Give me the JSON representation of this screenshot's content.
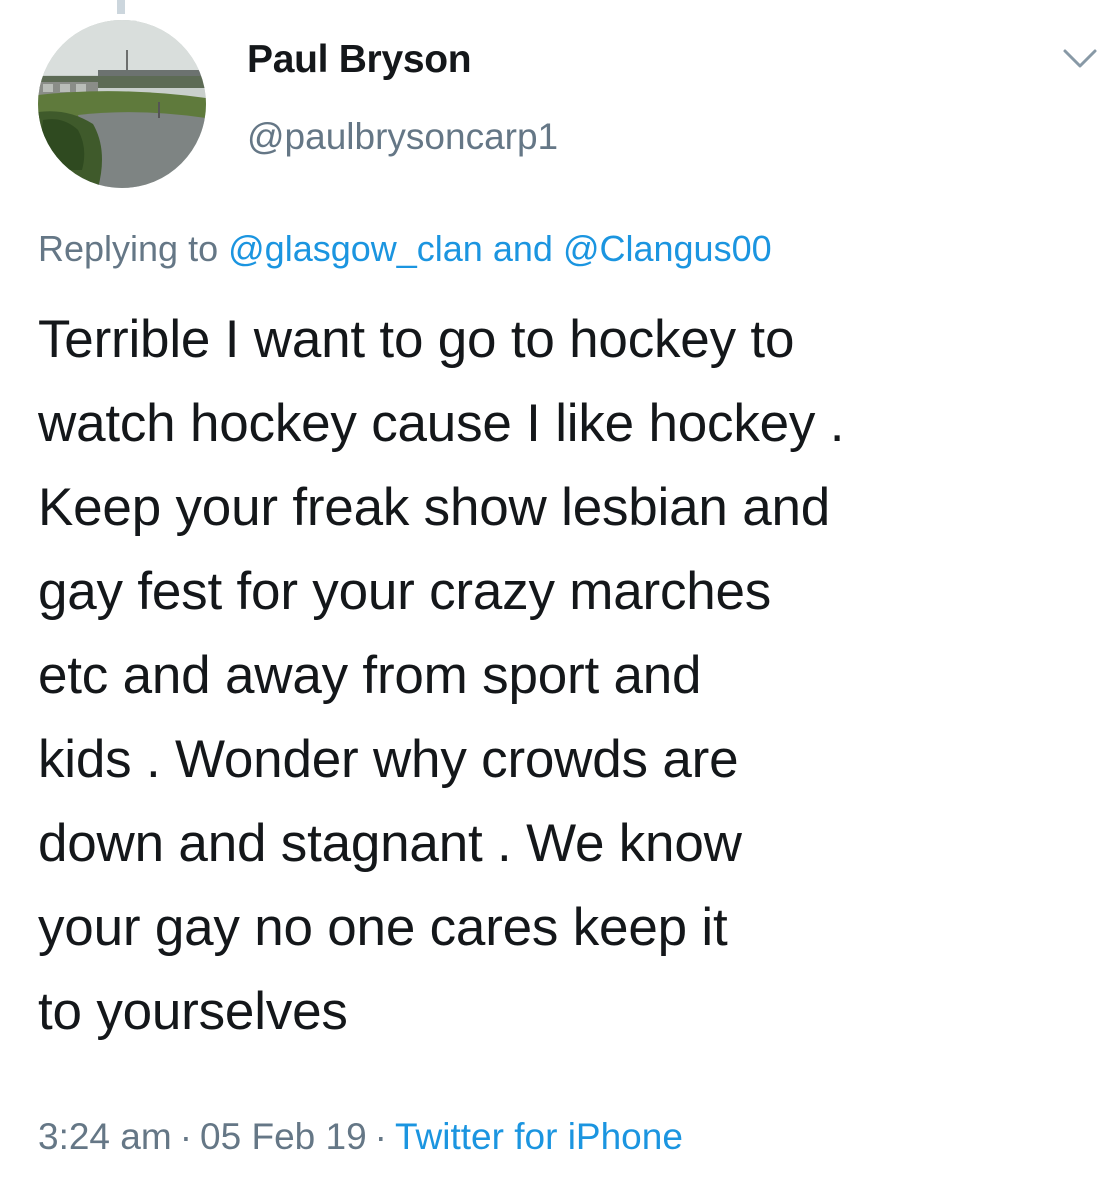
{
  "tweet": {
    "author": {
      "display_name": "Paul Bryson",
      "handle": "@paulbrysoncarp1"
    },
    "reply_context": {
      "prefix": "Replying to",
      "mention_1": "@glasgow_clan",
      "conjunction": "and",
      "mention_2": "@Clangus00"
    },
    "body_lines": [
      "Terrible I want to go to hockey to",
      "watch hockey cause I like hockey .",
      "Keep your freak show lesbian and",
      "gay fest for your crazy marches",
      "etc and away from sport and",
      "kids . Wonder why crowds are",
      "down and stagnant . We know",
      "your gay no one cares keep it",
      "to yourselves"
    ],
    "meta": {
      "time": "3:24 am",
      "date": "05 Feb 19",
      "separator": "·",
      "source": "Twitter for iPhone"
    }
  },
  "icons": {
    "menu": "chevron-down-icon",
    "avatar": "avatar-photo"
  },
  "colors": {
    "text": "#14171a",
    "secondary": "#657786",
    "link": "#1b95e0"
  }
}
